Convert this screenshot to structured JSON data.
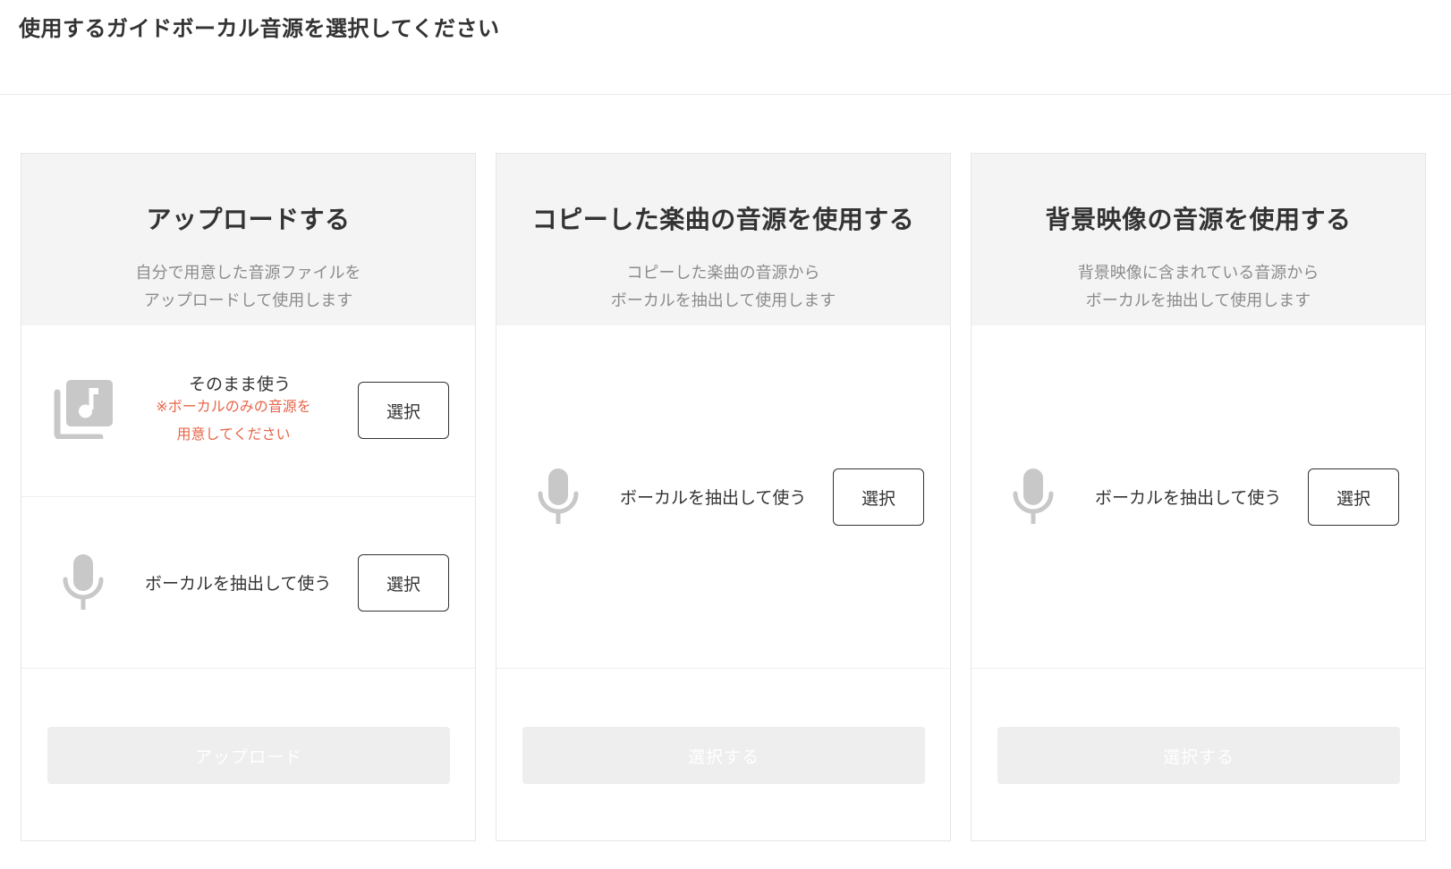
{
  "page": {
    "title": "使用するガイドボーカル音源を選択してください"
  },
  "colors": {
    "title_text": "#333333",
    "desc_text": "#8c8c8c",
    "note_text": "#e8664a",
    "card_head_bg": "#f4f4f4",
    "icon_gray": "#c8c8c8",
    "disabled_button_bg": "#eeeeee"
  },
  "cards": [
    {
      "title": "アップロードする",
      "desc_line1": "自分で用意した音源ファイルを",
      "desc_line2": "アップロードして使用します",
      "options": [
        {
          "icon": "music-library-icon",
          "label": "そのまま使う",
          "note_line1": "※ボーカルのみの音源を",
          "note_line2": "用意してください",
          "button": "選択"
        },
        {
          "icon": "microphone-icon",
          "label": "ボーカルを抽出して使う",
          "button": "選択"
        }
      ],
      "primary_button": "アップロード"
    },
    {
      "title": "コピーした楽曲の音源を使用する",
      "desc_line1": "コピーした楽曲の音源から",
      "desc_line2": "ボーカルを抽出して使用します",
      "options": [
        {
          "icon": "microphone-icon",
          "label": "ボーカルを抽出して使う",
          "button": "選択"
        }
      ],
      "primary_button": "選択する"
    },
    {
      "title": "背景映像の音源を使用する",
      "desc_line1": "背景映像に含まれている音源から",
      "desc_line2": "ボーカルを抽出して使用します",
      "options": [
        {
          "icon": "microphone-icon",
          "label": "ボーカルを抽出して使う",
          "button": "選択"
        }
      ],
      "primary_button": "選択する"
    }
  ]
}
